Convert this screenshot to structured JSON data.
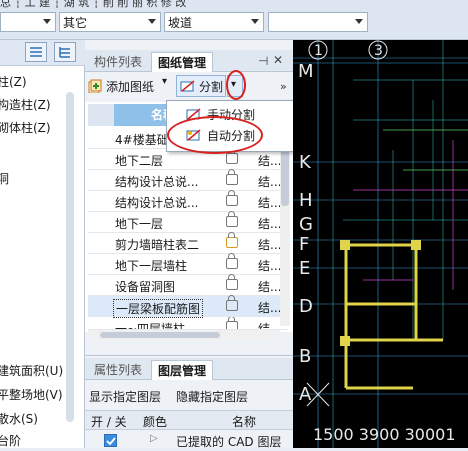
{
  "topbar": {
    "dropdown1": "",
    "dropdown2": "其它",
    "dropdown3": "坡道",
    "dropdown4": "",
    "partial_top": "总  ┆ 工   建  ┆ 湖 筑 ┆ 削 削 丽 积 修 改"
  },
  "left_panel": {
    "items": [
      "柱(Z)",
      "构造柱(Z)",
      "砌体柱(Z)",
      "洞",
      "建筑面积(U)",
      "平整场地(V)",
      "散水(S)",
      "台阶"
    ]
  },
  "tabs": {
    "component_list": "构件列表",
    "drawing_manage": "图纸管理"
  },
  "toolbar": {
    "add_drawing": "添加图纸",
    "split": "分割"
  },
  "split_menu": {
    "manual": "手动分割",
    "auto": "自动分割"
  },
  "grid": {
    "header_name": "名称",
    "rows": [
      {
        "name": "4#楼基础",
        "extra": ""
      },
      {
        "name": "地下二层",
        "extra": "结..."
      },
      {
        "name": "结构设计总说...",
        "extra": "结..."
      },
      {
        "name": "结构设计总说...",
        "extra": "结..."
      },
      {
        "name": "地下一层",
        "extra": "结..."
      },
      {
        "name": "剪力墙暗柱表二",
        "extra": "结..."
      },
      {
        "name": "地下一层墙柱",
        "extra": "结..."
      },
      {
        "name": "设备留洞图",
        "extra": "结..."
      },
      {
        "name": "一层梁板配筋图",
        "extra": "结..."
      },
      {
        "name": "一~四层墙柱",
        "extra": "结..."
      }
    ]
  },
  "lower_panel": {
    "tab_properties": "属性列表",
    "tab_layers": "图层管理",
    "show_layer": "显示指定图层",
    "hide_layer": "隐藏指定图层",
    "col_onoff": "开 / 关",
    "col_color": "颜色",
    "col_name": "名称",
    "row1_name": "已提取的 CAD 图层"
  },
  "cad": {
    "top_axes": [
      "1",
      "3"
    ],
    "left_axes": [
      "M",
      "K",
      "H",
      "G",
      "F",
      "E",
      "D",
      "B",
      "A"
    ],
    "bottom_dims": "1500 3900   30001"
  },
  "colors": {
    "accent": "#8fc0ea",
    "highlight": "#d8201f",
    "cad_bg": "#000000"
  }
}
